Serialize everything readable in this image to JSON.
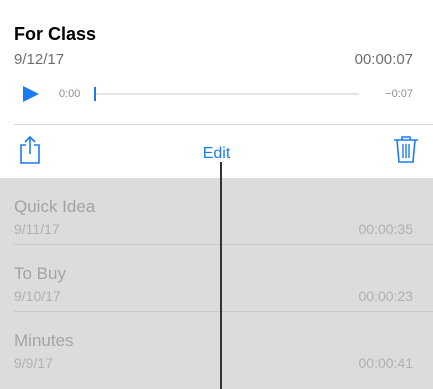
{
  "current_recording": {
    "title": "For Class",
    "date": "9/12/17",
    "duration": "00:00:07",
    "elapsed": "0:00",
    "remaining": "−0:07",
    "progress_fraction": 0
  },
  "actions": {
    "share_icon": "share-icon",
    "edit_label": "Edit",
    "delete_icon": "trash-icon"
  },
  "recordings": [
    {
      "title": "Quick Idea",
      "date": "9/11/17",
      "duration": "00:00:35"
    },
    {
      "title": "To Buy",
      "date": "9/10/17",
      "duration": "00:00:23"
    },
    {
      "title": "Minutes",
      "date": "9/9/17",
      "duration": "00:00:41"
    }
  ],
  "colors": {
    "accent": "#1a7cf5",
    "list_background": "#dcdcdc",
    "muted_text": "#a3a3a3"
  }
}
